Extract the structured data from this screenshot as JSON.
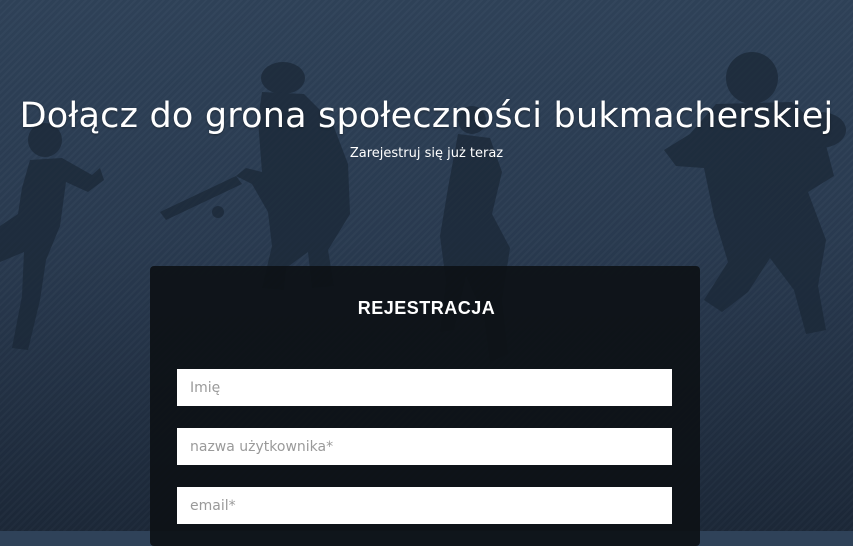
{
  "hero": {
    "title": "Dołącz do grona społeczności bukmacherskiej",
    "subtitle": "Zarejestruj się już teraz"
  },
  "form": {
    "heading": "REJESTRACJA",
    "fields": [
      {
        "placeholder": "Imię",
        "value": ""
      },
      {
        "placeholder": "nazwa użytkownika*",
        "value": ""
      },
      {
        "placeholder": "email*",
        "value": ""
      }
    ]
  },
  "colors": {
    "background": "#2c3e55",
    "card": "#0d1116",
    "text": "#ffffff",
    "placeholder": "#9a9a9a"
  }
}
